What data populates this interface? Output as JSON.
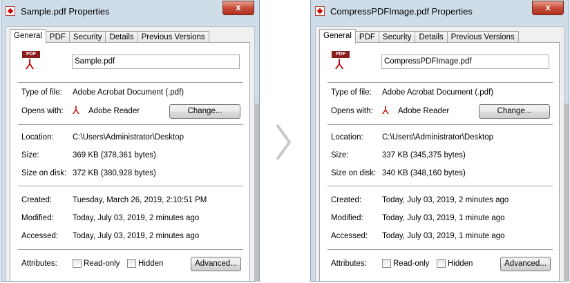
{
  "windows": [
    {
      "title": "Sample.pdf Properties",
      "close_label": "x",
      "tabs": [
        "General",
        "PDF",
        "Security",
        "Details",
        "Previous Versions"
      ],
      "file_name": "Sample.pdf",
      "labels": {
        "type_of_file": "Type of file:",
        "opens_with": "Opens with:",
        "location": "Location:",
        "size": "Size:",
        "size_on_disk": "Size on disk:",
        "created": "Created:",
        "modified": "Modified:",
        "accessed": "Accessed:",
        "attributes": "Attributes:"
      },
      "type_of_file": "Adobe Acrobat Document (.pdf)",
      "opens_with_app": "Adobe Reader",
      "change_button": "Change...",
      "location": "C:\\Users\\Administrator\\Desktop",
      "size": "369 KB (378,361 bytes)",
      "size_on_disk": "372 KB (380,928 bytes)",
      "created": "Tuesday, March 26, 2019, 2:10:51 PM",
      "modified": "Today, July 03, 2019, 2 minutes ago",
      "accessed": "Today, July 03, 2019, 2 minutes ago",
      "readonly_label": "Read-only",
      "hidden_label": "Hidden",
      "advanced_button": "Advanced...",
      "icon_tag": "PDF"
    },
    {
      "title": "CompressPDFImage.pdf Properties",
      "close_label": "x",
      "tabs": [
        "General",
        "PDF",
        "Security",
        "Details",
        "Previous Versions"
      ],
      "file_name": "CompressPDFImage.pdf",
      "labels": {
        "type_of_file": "Type of file:",
        "opens_with": "Opens with:",
        "location": "Location:",
        "size": "Size:",
        "size_on_disk": "Size on disk:",
        "created": "Created:",
        "modified": "Modified:",
        "accessed": "Accessed:",
        "attributes": "Attributes:"
      },
      "type_of_file": "Adobe Acrobat Document (.pdf)",
      "opens_with_app": "Adobe Reader",
      "change_button": "Change...",
      "location": "C:\\Users\\Administrator\\Desktop",
      "size": "337 KB (345,375 bytes)",
      "size_on_disk": "340 KB (348,160 bytes)",
      "created": "Today, July 03, 2019, 2 minutes ago",
      "modified": "Today, July 03, 2019, 1 minute ago",
      "accessed": "Today, July 03, 2019, 1 minute ago",
      "readonly_label": "Read-only",
      "hidden_label": "Hidden",
      "advanced_button": "Advanced...",
      "icon_tag": "PDF"
    }
  ],
  "icons": {
    "pdf": "pdf-file-icon",
    "reader": "adobe-reader-icon",
    "close": "close-icon",
    "arrow": "chevron-right-icon"
  },
  "colors": {
    "window_frame": "#cfdde9",
    "close_button": "#c74b3a",
    "pdf_red": "#c40000",
    "arrow": "#c8c8c8"
  }
}
